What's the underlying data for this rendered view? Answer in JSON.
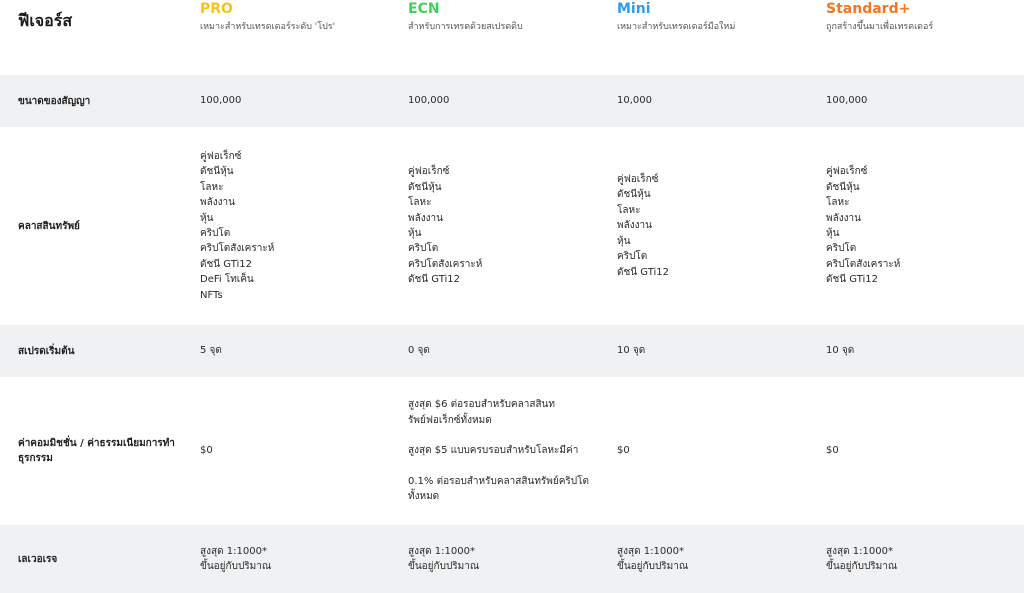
{
  "header": {
    "features_label": "ฟีเจอร์ส",
    "accounts": [
      {
        "name": "PRO",
        "color": "#f7c31a",
        "description": "เหมาะสำหรับเทรดเดอร์ระดับ 'โปร'"
      },
      {
        "name": "ECN",
        "color": "#3fd25a",
        "description": "สำหรับการเทรดด้วยสเปรดดิบ"
      },
      {
        "name": "Mini",
        "color": "#2f9bf0",
        "description": "เหมาะสำหรับเทรดเดอร์มือใหม่"
      },
      {
        "name": "Standard+",
        "color": "#f5761c",
        "description": "ถูกสร้างขึ้นมาเพื่อเทรดเดอร์"
      }
    ]
  },
  "rows": [
    {
      "label": "ขนาดของสัญญา",
      "values": [
        [
          "100,000"
        ],
        [
          "100,000"
        ],
        [
          "10,000"
        ],
        [
          "100,000"
        ]
      ]
    },
    {
      "label": "คลาสสินทรัพย์",
      "values": [
        [
          "คู่ฟอเร็กซ์",
          "ดัชนีหุ้น",
          "โลหะ",
          "พลังงาน",
          "หุ้น",
          "คริปโต",
          "คริปโตสังเคราะห์",
          "ดัชนี GTi12",
          "DeFi โทเค็น",
          "NFTs"
        ],
        [
          "คู่ฟอเร็กซ์",
          "ดัชนีหุ้น",
          "โลหะ",
          "พลังงาน",
          "หุ้น",
          "คริปโต",
          "คริปโตสังเคราะห์",
          "ดัชนี GTi12"
        ],
        [
          "คู่ฟอเร็กซ์",
          "ดัชนีหุ้น",
          "โลหะ",
          "พลังงาน",
          "หุ้น",
          "คริปโต",
          "ดัชนี GTi12"
        ],
        [
          "คู่ฟอเร็กซ์",
          "ดัชนีหุ้น",
          "โลหะ",
          "พลังงาน",
          "หุ้น",
          "คริปโต",
          "คริปโตสังเคราะห์",
          "ดัชนี GTi12"
        ]
      ]
    },
    {
      "label": "สเปรดเริ่มต้น",
      "values": [
        [
          "5 จุด"
        ],
        [
          "0 จุด"
        ],
        [
          "10 จุด"
        ],
        [
          "10 จุด"
        ]
      ]
    },
    {
      "label": "ค่าคอมมิชชั่น / ค่าธรรมเนียมการทำธุรกรรม",
      "values": [
        [
          "$0"
        ],
        [
          "สูงสุด $6 ต่อรอบสำหรับคลาสสินทรัพย์ฟอเร็กซ์ทั้งหมด",
          "สูงสุด $5 แบบครบรอบสำหรับโลหะมีค่า",
          "0.1% ต่อรอบสำหรับคลาสสินทรัพย์คริปโตทั้งหมด"
        ],
        [
          "$0"
        ],
        [
          "$0"
        ]
      ]
    },
    {
      "label": "เลเวอเรจ",
      "values": [
        [
          "สูงสุด 1:1000*",
          "ขึ้นอยู่กับปริมาณ"
        ],
        [
          "สูงสุด 1:1000*",
          "ขึ้นอยู่กับปริมาณ"
        ],
        [
          "สูงสุด 1:1000*",
          "ขึ้นอยู่กับปริมาณ"
        ],
        [
          "สูงสุด 1:1000*",
          "ขึ้นอยู่กับปริมาณ"
        ]
      ]
    }
  ]
}
